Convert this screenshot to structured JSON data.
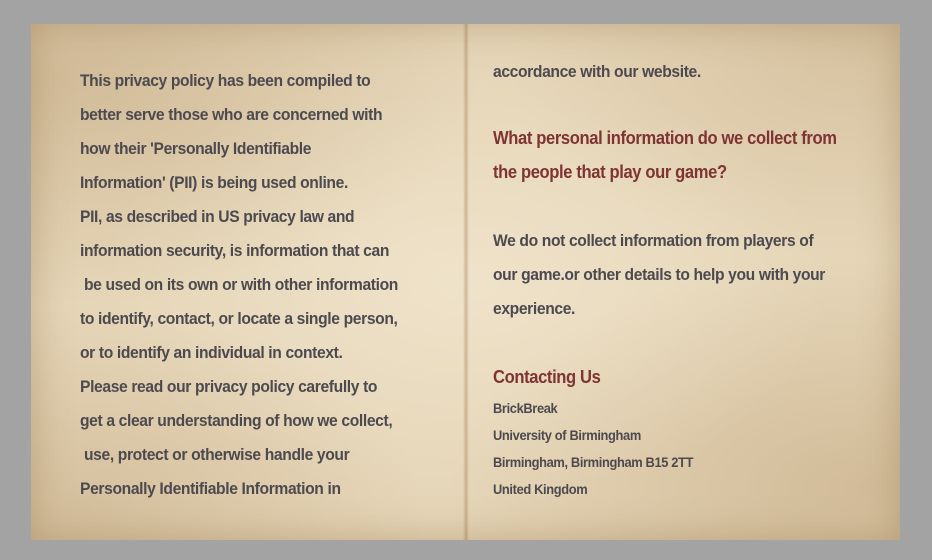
{
  "left_page": {
    "lines": [
      "This privacy policy has been compiled to",
      "better serve those who are concerned with",
      "how their 'Personally Identifiable",
      "Information' (PII) is being used online.",
      "PII, as described in US privacy law and",
      "information security, is information that can",
      " be used on its own or with other information",
      "to identify, contact, or locate a single person,",
      "or to identify an individual in context.",
      "Please read our privacy policy carefully to",
      "get a clear understanding of how we collect,",
      " use, protect or otherwise handle your",
      "Personally Identifiable Information in"
    ]
  },
  "right_page": {
    "continuation": "accordance with our website.",
    "question_heading": [
      "What personal information do we collect from",
      "the people that play our game?"
    ],
    "answer": [
      "We do not collect information from players of",
      "our game.or other details to help you with your",
      "experience."
    ],
    "contact_heading": "Contacting Us",
    "contact_lines": [
      "BrickBreak",
      "University of Birmingham",
      "Birmingham, Birmingham B15 2TT",
      "United Kingdom"
    ]
  },
  "colors": {
    "background": "#a3a3a3",
    "paper": "#e6d6b8",
    "body_text": "#4d4a4f",
    "heading_text": "#7e3434"
  }
}
